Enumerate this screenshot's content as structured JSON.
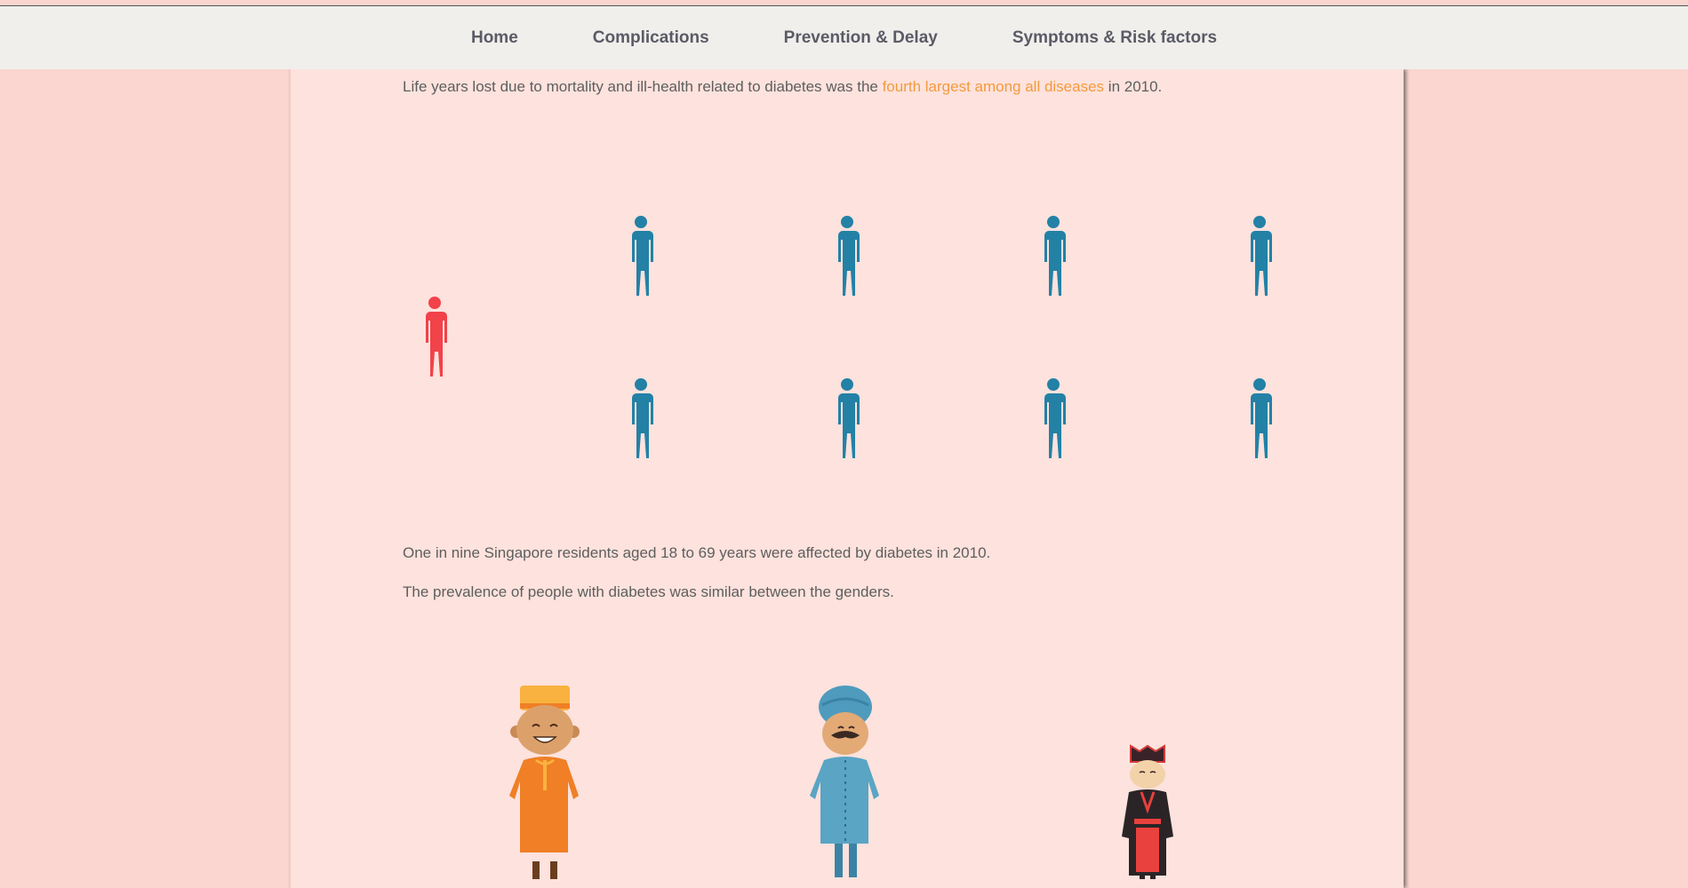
{
  "nav": {
    "items": [
      {
        "label": "Home"
      },
      {
        "label": "Complications"
      },
      {
        "label": "Prevention & Delay"
      },
      {
        "label": "Symptoms & Risk factors"
      }
    ]
  },
  "content": {
    "line1": {
      "before": "Life years lost due to mortality and ill-health related to diabetes was the ",
      "highlight": "fourth largest among all diseases",
      "after": " in 2010."
    },
    "line2": "One in nine Singapore residents aged 18 to 69 years were affected by diabetes in 2010.",
    "line3": "The prevalence of people with diabetes was similar between the genders."
  },
  "pictogram": {
    "highlight_count": 1,
    "other_count": 8,
    "highlight_color": "#f2424a",
    "other_color": "#2381a6",
    "icon": "person-icon"
  },
  "ethnic_figures": [
    {
      "icon": "malay-man-icon"
    },
    {
      "icon": "indian-man-icon"
    },
    {
      "icon": "chinese-man-icon"
    }
  ],
  "colors": {
    "page_bg": "#fbd5cf",
    "content_bg": "#fde2dd",
    "nav_bg": "#f0efec",
    "accent": "#f39a3d"
  }
}
